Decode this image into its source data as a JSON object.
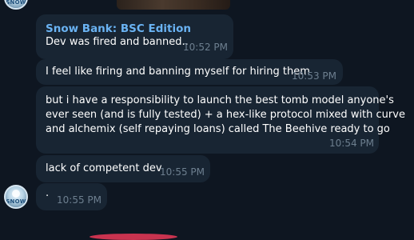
{
  "chat": {
    "group_avatar_text": "SNOW",
    "messages": [
      {
        "sender": "Snow Bank: BSC Edition",
        "text": "Dev was fired and banned..",
        "time": "10:52 PM"
      },
      {
        "text": "I feel like firing and banning myself for hiring them",
        "time": "10:53 PM"
      },
      {
        "lines": [
          "but i have a responsibility to launch the best tomb model anyone's",
          "ever seen (and is fully tested) + a hex-like protocol mixed with curve",
          "and alchemix (self repaying loans) called The Beehive ready to go"
        ],
        "time": "10:54 PM"
      },
      {
        "text": "lack of competent dev",
        "time": "10:55 PM"
      },
      {
        "text": "·",
        "time": "10:55 PM"
      }
    ]
  },
  "colors": {
    "background": "#0e1621",
    "bubble": "#182533",
    "sender_name": "#6ab3f3",
    "timestamp": "#6d7f8f"
  },
  "icons": {
    "avatar": "snow-avatar-icon"
  }
}
